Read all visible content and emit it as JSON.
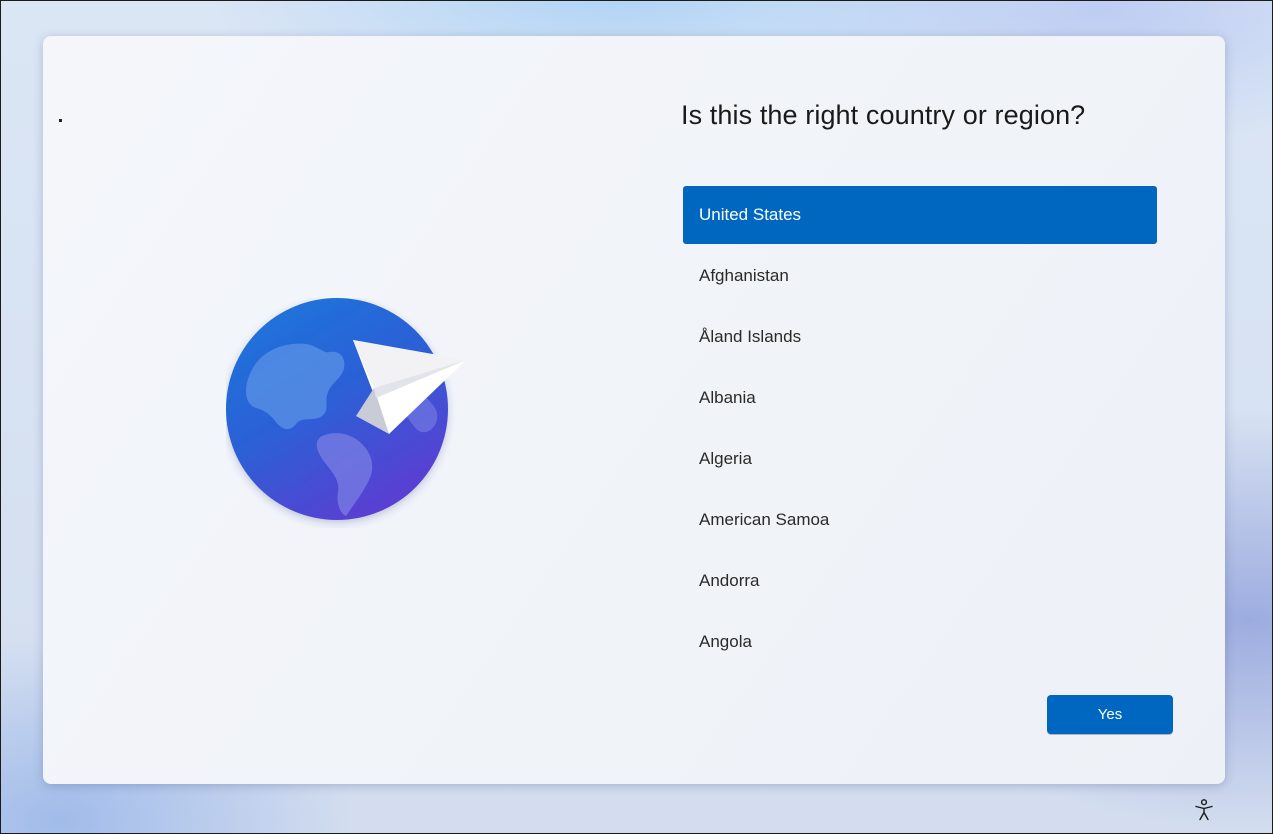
{
  "page": {
    "question": "Is this the right country or region?"
  },
  "countries": [
    {
      "label": "United States",
      "selected": true
    },
    {
      "label": "Afghanistan",
      "selected": false
    },
    {
      "label": "Åland Islands",
      "selected": false
    },
    {
      "label": "Albania",
      "selected": false
    },
    {
      "label": "Algeria",
      "selected": false
    },
    {
      "label": "American Samoa",
      "selected": false
    },
    {
      "label": "Andorra",
      "selected": false
    },
    {
      "label": "Angola",
      "selected": false
    }
  ],
  "actions": {
    "yes_label": "Yes"
  },
  "icons": {
    "illustration": "globe-paper-plane-icon",
    "accessibility": "accessibility-icon"
  },
  "colors": {
    "accent": "#0067c0",
    "selected_text": "#ffffff"
  }
}
